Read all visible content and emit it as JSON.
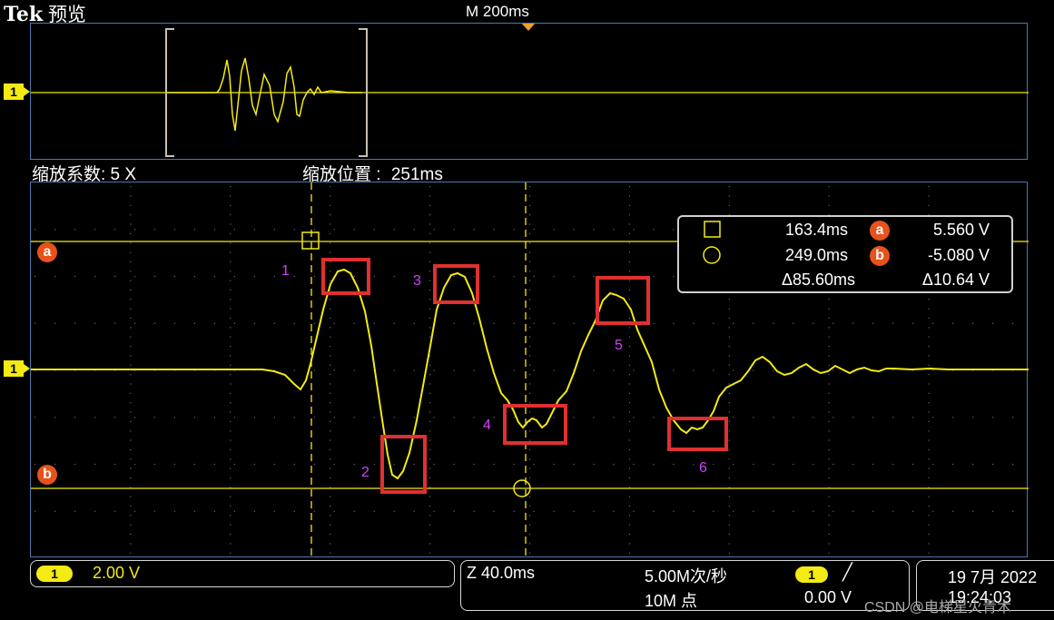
{
  "header": {
    "brand": "Tek",
    "mode": "预览",
    "timebase": "M 200ms"
  },
  "overview": {
    "channel_marker": "1"
  },
  "zoom": {
    "factor_label": "缩放系数: 5 X",
    "position_label": "缩放位置 :",
    "position_value": "251ms"
  },
  "markers": {
    "channel": "1",
    "cursor_a": "a",
    "cursor_b": "b"
  },
  "annotations": [
    "1",
    "2",
    "3",
    "4",
    "5",
    "6"
  ],
  "cursor_readout": {
    "time_a": "163.4ms",
    "volt_a": "5.560 V",
    "time_b": "249.0ms",
    "volt_b": "-5.080 V",
    "delta_time": "Δ85.60ms",
    "delta_volt": "Δ10.64 V",
    "symbol_a": "a",
    "symbol_b": "b"
  },
  "bottom_bar": {
    "ch1_chip": "1",
    "ch1_scale": "2.00 V",
    "zoom_time": "Z 40.0ms",
    "sample_rate": "5.00M次/秒",
    "record_length": "10M 点",
    "trigger_chip": "1",
    "trigger_slope": "╱",
    "trigger_level": "0.00 V",
    "date": "19 7月 2022",
    "time": "19:24:03"
  },
  "watermark": "CSDN @电梯星火青木",
  "colors": {
    "trace": "#f4ea14",
    "graticule_border": "#4a7ab0",
    "cursor_marker": "#e8521a",
    "annotation_box": "#e03030",
    "annotation_text": "#d040ff"
  }
}
